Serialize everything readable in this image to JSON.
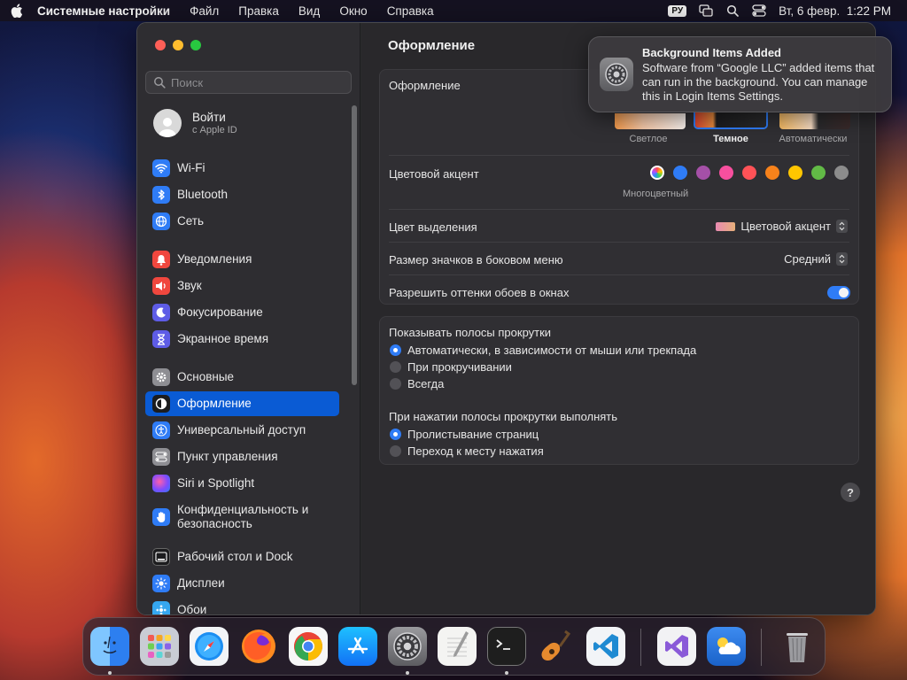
{
  "menubar": {
    "app_name": "Системные настройки",
    "menus": [
      "Файл",
      "Правка",
      "Вид",
      "Окно",
      "Справка"
    ],
    "input_source": "РУ",
    "clock": "Вт, 6 февр.  1:22 PM"
  },
  "sidebar": {
    "search_placeholder": "Поиск",
    "account": {
      "title": "Войти",
      "subtitle": "с Apple ID"
    },
    "items": [
      {
        "label": "Wi-Fi",
        "icon": "wifi-icon",
        "color": "#2f7cf6"
      },
      {
        "label": "Bluetooth",
        "icon": "bluetooth-icon",
        "color": "#2f7cf6"
      },
      {
        "label": "Сеть",
        "icon": "globe-icon",
        "color": "#2f7cf6"
      },
      {
        "label": "Уведомления",
        "icon": "bell-icon",
        "color": "#f0473e"
      },
      {
        "label": "Звук",
        "icon": "speaker-icon",
        "color": "#f0473e"
      },
      {
        "label": "Фокусирование",
        "icon": "moon-icon",
        "color": "#5e5ce6"
      },
      {
        "label": "Экранное время",
        "icon": "hourglass-icon",
        "color": "#5e5ce6"
      },
      {
        "label": "Основные",
        "icon": "gear-icon",
        "color": "#8e8e93"
      },
      {
        "label": "Оформление",
        "icon": "appearance-icon",
        "color": "#1c1c1e"
      },
      {
        "label": "Универсальный доступ",
        "icon": "accessibility-icon",
        "color": "#2f7cf6"
      },
      {
        "label": "Пункт управления",
        "icon": "control-center-icon",
        "color": "#8e8e93"
      },
      {
        "label": "Siri и Spotlight",
        "icon": "siri-icon",
        "color": "#b04fd8"
      },
      {
        "label": "Конфиденциальность и безопасность",
        "icon": "hand-icon",
        "color": "#2f7cf6"
      },
      {
        "label": "Рабочий стол и Dock",
        "icon": "dock-icon",
        "color": "#1c1c1e"
      },
      {
        "label": "Дисплеи",
        "icon": "sun-icon",
        "color": "#2f7cf6"
      },
      {
        "label": "Обои",
        "icon": "wallpaper-icon",
        "color": "#35a7f0"
      }
    ],
    "active_item": "Оформление"
  },
  "main": {
    "title": "Оформление",
    "appearance": {
      "label": "Оформление",
      "options": [
        "Светлое",
        "Темное",
        "Автоматически"
      ],
      "selected": "Темное"
    },
    "accent": {
      "label": "Цветовой акцент",
      "selected_caption": "Многоцветный",
      "colors": [
        "#2f7cf6",
        "#a550a7",
        "#f74f9e",
        "#ff5257",
        "#f7821b",
        "#ffc600",
        "#62ba46",
        "#8c8c8c"
      ]
    },
    "highlight": {
      "label": "Цвет выделения",
      "value": "Цветовой акцент"
    },
    "icon_size": {
      "label": "Размер значков в боковом меню",
      "value": "Средний"
    },
    "tinting": {
      "label": "Разрешить оттенки обоев в окнах",
      "enabled": true
    },
    "scrollbars": {
      "label": "Показывать полосы прокрутки",
      "options": [
        "Автоматически, в зависимости от мыши или трекпада",
        "При прокручивании",
        "Всегда"
      ],
      "selected": 0
    },
    "click_scroll": {
      "label": "При нажатии полосы прокрутки выполнять",
      "options": [
        "Пролистывание страниц",
        "Переход к месту нажатия"
      ],
      "selected": 0
    },
    "help": "?"
  },
  "notification": {
    "title": "Background Items Added",
    "body": "Software from “Google LLC” added items that can run in the background. You can manage this in Login Items Settings."
  },
  "dock": {
    "apps": [
      "Finder",
      "Launchpad",
      "Safari",
      "Firefox",
      "Chrome",
      "App Store",
      "System Settings",
      "TextEdit",
      "Terminal",
      "GarageBand",
      "Visual Studio Code",
      "Visual Studio",
      "Weather",
      "Trash"
    ],
    "running": [
      "Finder",
      "System Settings",
      "Terminal"
    ]
  }
}
